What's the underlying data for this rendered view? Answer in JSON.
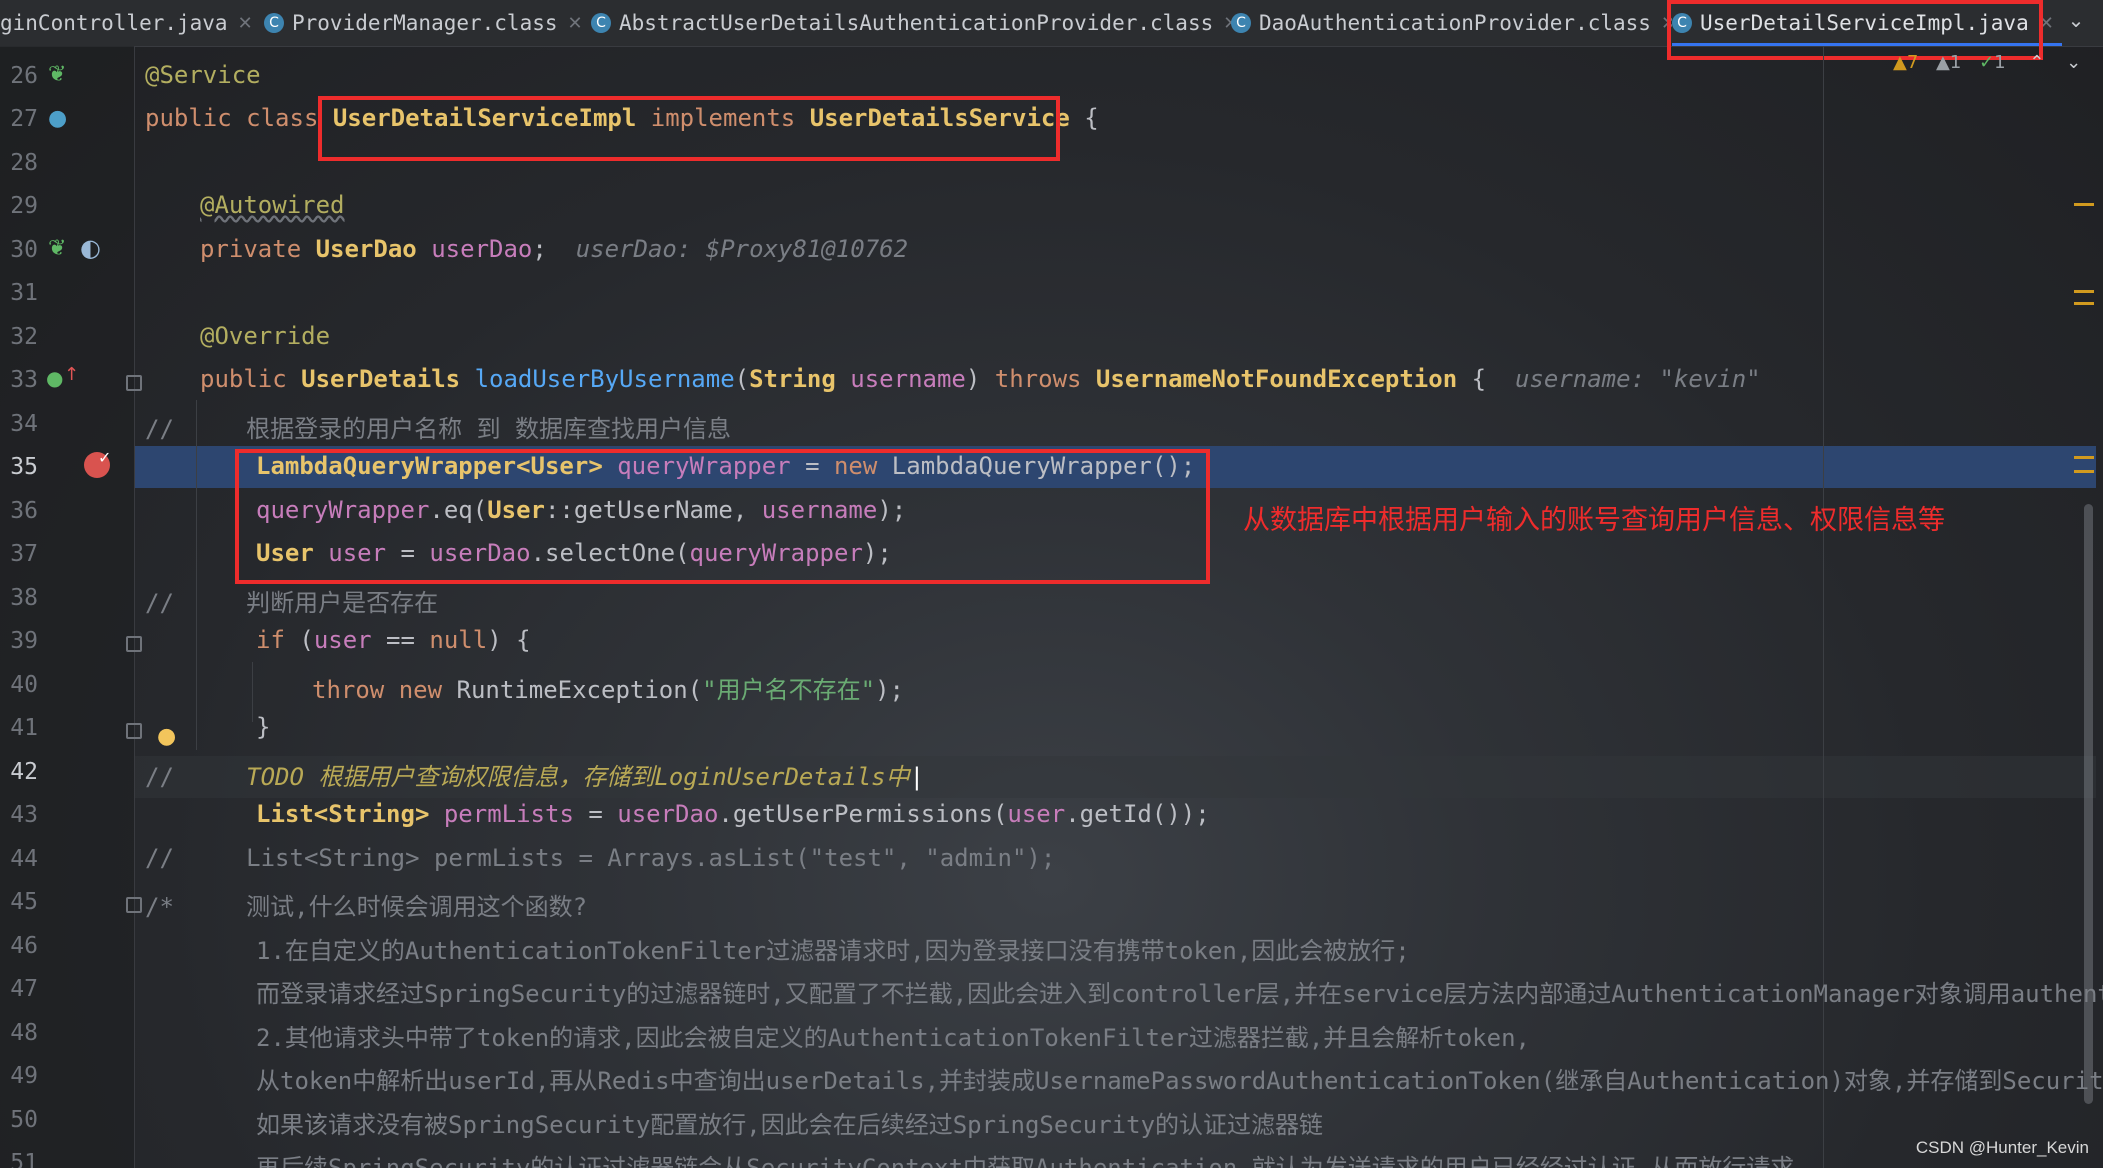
{
  "tabs": [
    {
      "label": "ginController.java",
      "icon": "java-file-icon"
    },
    {
      "label": "ProviderManager.class",
      "icon": "class-file-icon"
    },
    {
      "label": "AbstractUserDetailsAuthenticationProvider.class",
      "icon": "class-file-icon"
    },
    {
      "label": "DaoAuthenticationProvider.class",
      "icon": "class-file-icon"
    },
    {
      "label": "UserDetailServiceImpl.java",
      "icon": "class-file-icon",
      "active": true
    }
  ],
  "inspection": {
    "warnings": "7",
    "weak_warnings": "1",
    "typos": "1"
  },
  "code": {
    "l26": {
      "num": "26",
      "annot": "@Service"
    },
    "l27": {
      "num": "27",
      "kw_public": "public",
      "kw_class": "class",
      "class_name": "UserDetailServiceImpl",
      "kw_implements": "implements",
      "iface": "UserDetailsService",
      "brace": "{"
    },
    "l28": {
      "num": "28"
    },
    "l29": {
      "num": "29",
      "annot": "@Autowired"
    },
    "l30": {
      "num": "30",
      "kw": "private",
      "type": "UserDao",
      "field": "userDao",
      "semi": ";",
      "hint": "userDao: $Proxy81@10762"
    },
    "l31": {
      "num": "31"
    },
    "l32": {
      "num": "32",
      "annot": "@Override"
    },
    "l33": {
      "num": "33",
      "kw": "public",
      "ret": "UserDetails",
      "method": "loadUserByUsername",
      "paren_open": "(",
      "ptype": "String",
      "pname": "username",
      "paren_close": ")",
      "throws": "throws",
      "exc": "UsernameNotFoundException",
      "brace": "{",
      "hint": "username: \"kevin\""
    },
    "l34": {
      "num": "34",
      "text": "//     根据登录的用户名称 到 数据库查找用户信息"
    },
    "l35": {
      "num": "35",
      "type": "LambdaQueryWrapper<User>",
      "var": "queryWrapper",
      "rest1": " = ",
      "kw_new": "new",
      "rest2": " LambdaQueryWrapper();"
    },
    "l36": {
      "num": "36",
      "var": "queryWrapper",
      "call": ".eq(",
      "ref": "User",
      "ref2": "::getUserName, ",
      "arg": "username",
      "end": ");"
    },
    "l37": {
      "num": "37",
      "type": "User",
      "var": "user",
      "mid": " = ",
      "dao": "userDao",
      "call": ".selectOne(",
      "arg": "queryWrapper",
      "end": ");"
    },
    "l38": {
      "num": "38",
      "text": "//     判断用户是否存在"
    },
    "l39": {
      "num": "39",
      "kw_if": "if",
      "open": " (",
      "var": "user",
      "op": " == ",
      "kw_null": "null",
      "close": ") {"
    },
    "l40": {
      "num": "40",
      "kw_throw": "throw",
      "kw_new": "new",
      "exc": " RuntimeException(",
      "str": "\"用户名不存在\"",
      "end": ");"
    },
    "l41": {
      "num": "41",
      "text": "}"
    },
    "l42": {
      "num": "42",
      "slash": "//",
      "todo": "TODO 根据用户查询权限信息，存储到LoginUserDetails中"
    },
    "l43": {
      "num": "43",
      "type": "List<String>",
      "var": "permLists",
      "mid": " = ",
      "dao": "userDao",
      "call": ".getUserPermissions(",
      "arg": "user",
      "end": ".getId());"
    },
    "l44": {
      "num": "44",
      "text": "//     List<String> permLists = Arrays.asList(\"test\", \"admin\");"
    },
    "l45": {
      "num": "45",
      "text": "/*     测试,什么时候会调用这个函数?"
    },
    "l46": {
      "num": "46",
      "text": "1.在自定义的AuthenticationTokenFilter过滤器请求时,因为登录接口没有携带token,因此会被放行;"
    },
    "l47": {
      "num": "47",
      "text": "而登录请求经过SpringSecurity的过滤器链时,又配置了不拦截,因此会进入到controller层,并在service层方法内部通过AuthenticationManager对象调用authenti"
    },
    "l48": {
      "num": "48",
      "text": "2.其他请求头中带了token的请求,因此会被自定义的AuthenticationTokenFilter过滤器拦截,并且会解析token,"
    },
    "l49": {
      "num": "49",
      "text": "从token中解析出userId,再从Redis中查询出userDetails,并封装成UsernamePasswordAuthenticationToken(继承自Authentication)对象,并存储到SecurityC"
    },
    "l50": {
      "num": "50",
      "text": "如果该请求没有被SpringSecurity配置放行,因此会在后续经过SpringSecurity的认证过滤器链"
    },
    "l51": {
      "num": "51",
      "text": "再后续SpringSecurity的认证过滤器链会从SecurityContext中获取Authentication,就认为发送请求的用户已经经过认证,从而放行请求"
    }
  },
  "annotation": "从数据库中根据用户输入的账号查询用户信息、权限信息等",
  "watermark": "CSDN @Hunter_Kevin",
  "colors": {
    "highlight": "#2d4670",
    "redbox": "#ee2c2c",
    "keyword": "#cf8e6d",
    "class": "#e8c46b"
  }
}
